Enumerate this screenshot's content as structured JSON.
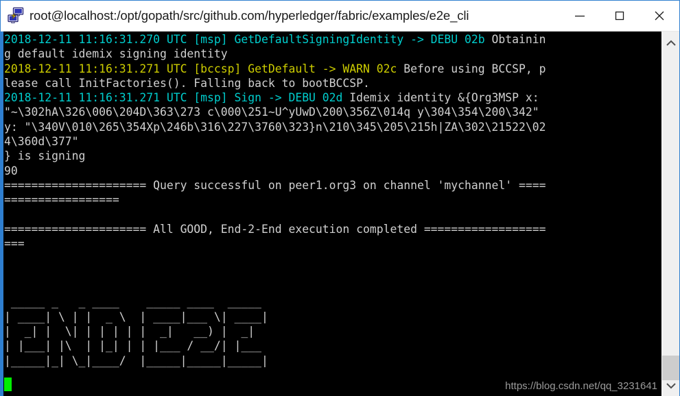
{
  "window": {
    "title": "root@localhost:/opt/gopath/src/github.com/hyperledger/fabric/examples/e2e_cli",
    "icon_name": "putty-terminal-icon",
    "border_color": "#2f7fd0"
  },
  "titlebar_buttons": {
    "minimize": "—",
    "maximize": "□",
    "close": "✕"
  },
  "terminal": {
    "background": "#000000",
    "default_fg": "#d0d0d0",
    "debug_color": "#00cdcd",
    "warn_color": "#cdcd00",
    "cursor_color": "#00ee00",
    "lines": [
      {
        "segments": [
          {
            "text": "2018-12-11 11:16:31.270 UTC [msp] GetDefaultSigningIdentity -> DEBU 02b ",
            "color": "cyan"
          },
          {
            "text": "Obtainin",
            "color": "grey"
          }
        ]
      },
      {
        "segments": [
          {
            "text": "g default idemix signing identity",
            "color": "grey"
          }
        ]
      },
      {
        "segments": [
          {
            "text": "2018-12-11 11:16:31.271 UTC [bccsp] GetDefault -> WARN 02c ",
            "color": "yellow"
          },
          {
            "text": "Before using BCCSP, p",
            "color": "grey"
          }
        ]
      },
      {
        "segments": [
          {
            "text": "lease call InitFactories(). Falling back to bootBCCSP.",
            "color": "grey"
          }
        ]
      },
      {
        "segments": [
          {
            "text": "2018-12-11 11:16:31.271 UTC [msp] Sign -> DEBU 02d ",
            "color": "cyan"
          },
          {
            "text": "Idemix identity &{Org3MSP x:",
            "color": "grey"
          }
        ]
      },
      {
        "segments": [
          {
            "text": "\"~\\302hA\\326\\006\\204D\\363\\273 c\\000\\251~U^yUwD\\200\\356Z\\014q y\\304\\354\\200\\342\"",
            "color": "grey"
          }
        ]
      },
      {
        "segments": [
          {
            "text": "y: \"\\340V\\010\\265\\354Xp\\246b\\316\\227\\3760\\323}n\\210\\345\\205\\215h|ZA\\302\\21522\\02",
            "color": "grey"
          }
        ]
      },
      {
        "segments": [
          {
            "text": "4\\360d\\377\"",
            "color": "grey"
          }
        ]
      },
      {
        "segments": [
          {
            "text": "} is signing",
            "color": "grey"
          }
        ]
      },
      {
        "segments": [
          {
            "text": "90",
            "color": "grey"
          }
        ]
      },
      {
        "segments": [
          {
            "text": "===================== Query successful on peer1.org3 on channel 'mychannel' ====",
            "color": "grey"
          }
        ]
      },
      {
        "segments": [
          {
            "text": "=================",
            "color": "grey"
          }
        ]
      },
      {
        "segments": [
          {
            "text": "",
            "color": "grey"
          }
        ]
      },
      {
        "segments": [
          {
            "text": "===================== All GOOD, End-2-End execution completed ==================",
            "color": "grey"
          }
        ]
      },
      {
        "segments": [
          {
            "text": "===",
            "color": "grey"
          }
        ]
      },
      {
        "segments": [
          {
            "text": "",
            "color": "grey"
          }
        ]
      },
      {
        "segments": [
          {
            "text": "",
            "color": "grey"
          }
        ]
      },
      {
        "segments": [
          {
            "text": "",
            "color": "grey"
          }
        ]
      }
    ],
    "banner_text": "END_E2E",
    "banner": [
      " _____ _   _ ____    _____ ____  _____ ",
      "| ____| \\ | |  _ \\  | ____|___ \\| ____|",
      "|  _| |  \\| | | | | |  _|   __) |  _|  ",
      "| |___| |\\  | |_| | | |___ / __/| |___ ",
      "|_____|_| \\_|____/  |_____|_____|_____|"
    ],
    "prompt_cursor": "█",
    "watermark": "https://blog.csdn.net/qq_3231641"
  },
  "scrollbar": {
    "up_arrow": "⌃",
    "down_arrow": "⌄",
    "thumb_color": "#cdcdcd",
    "track_color": "#f0f0f0"
  }
}
